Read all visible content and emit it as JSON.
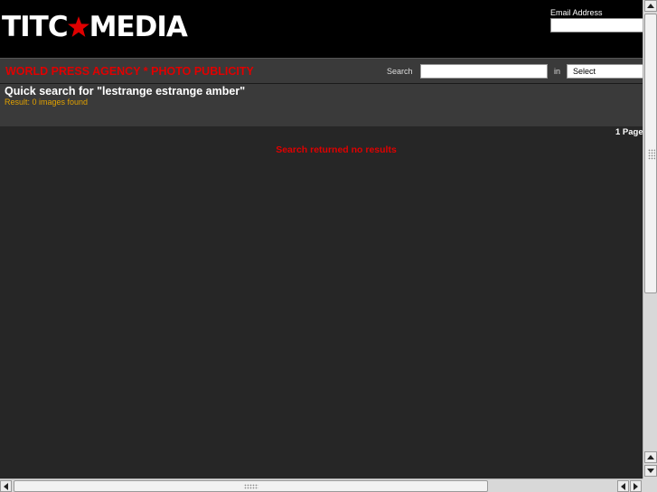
{
  "header": {
    "logo": {
      "left": "TITC",
      "right": "MEDIA",
      "star_color": "#e00000"
    },
    "email_label": "Email Address",
    "email_value": ""
  },
  "navbar": {
    "agency_title": "WORLD PRESS AGENCY * PHOTO PUBLICITY",
    "search_label": "Search",
    "search_value": "",
    "in_label": "in",
    "select_value": "Select"
  },
  "results": {
    "query_title": "Quick search for \"lestrange estrange amber\"",
    "result_count": "Result: 0 images found",
    "pager": "1 Page",
    "empty_message": "Search returned no results"
  },
  "colors": {
    "accent_red": "#e00000",
    "result_count": "#e0a000",
    "background": "#262626"
  }
}
